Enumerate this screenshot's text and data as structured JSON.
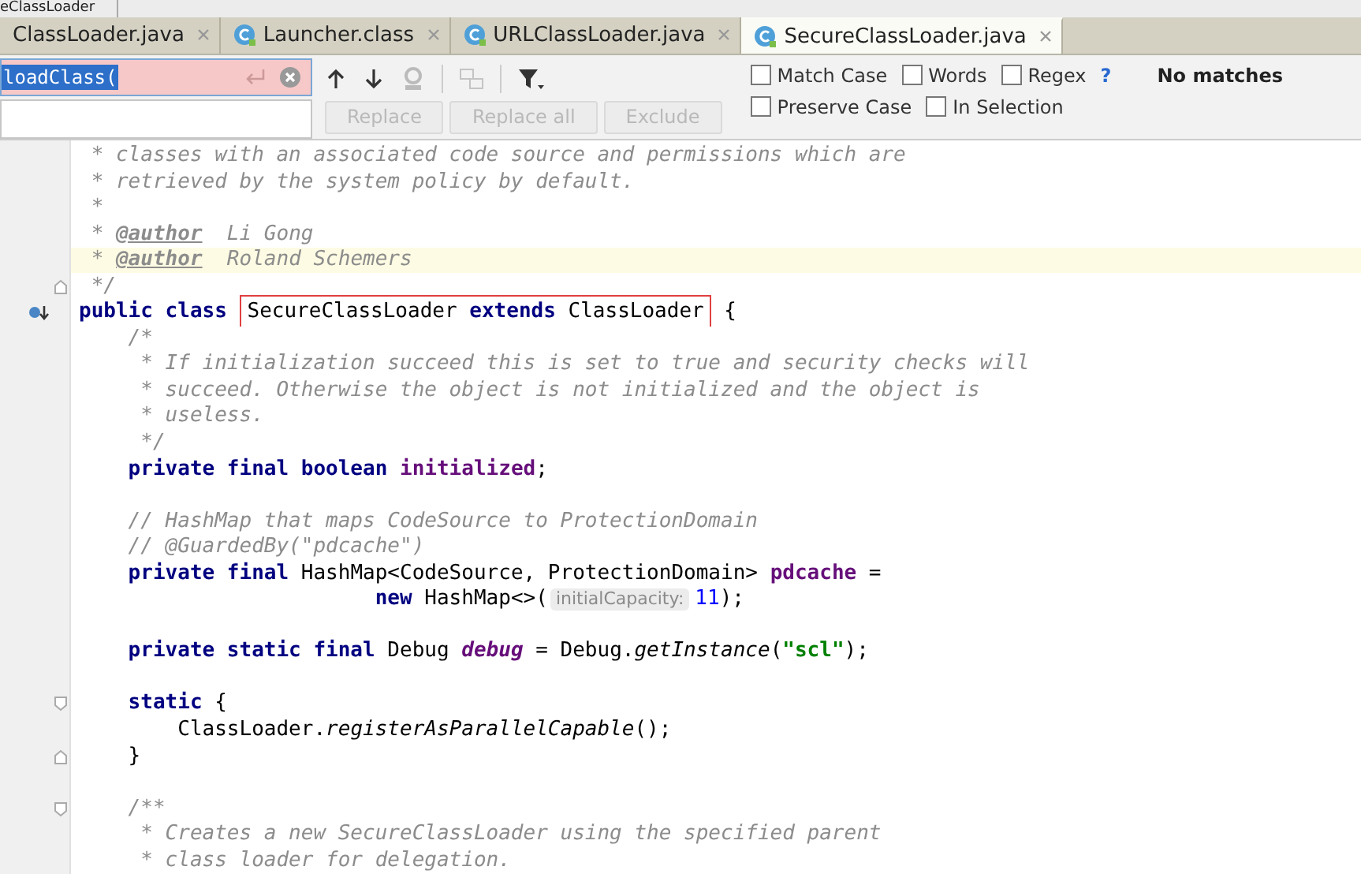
{
  "breadcrumb": "eClassLoader",
  "tabs": [
    {
      "label": "ClassLoader.java",
      "selected": false,
      "icon": false
    },
    {
      "label": "Launcher.class",
      "selected": false,
      "icon": true
    },
    {
      "label": "URLClassLoader.java",
      "selected": false,
      "icon": true
    },
    {
      "label": "SecureClassLoader.java",
      "selected": true,
      "icon": true
    }
  ],
  "find": {
    "query": "loadClass(",
    "no_match": true,
    "replace_buttons": [
      {
        "label": "Replace",
        "disabled": true
      },
      {
        "label": "Replace all",
        "disabled": true
      },
      {
        "label": "Exclude",
        "disabled": true
      }
    ],
    "options_row1": [
      {
        "label": "Match Case",
        "checked": false
      },
      {
        "label": "Words",
        "checked": false
      },
      {
        "label": "Regex",
        "checked": false
      }
    ],
    "help": "?",
    "status": "No matches",
    "options_row2": [
      {
        "label": "Preserve Case",
        "checked": false
      },
      {
        "label": "In Selection",
        "checked": false
      }
    ]
  },
  "lines": [
    {
      "current": false,
      "tokens": [
        {
          "kind": "comment",
          "text": " * classes with an associated code source and permissions which are"
        }
      ]
    },
    {
      "current": false,
      "tokens": [
        {
          "kind": "comment",
          "text": " * retrieved by the system policy by default."
        }
      ]
    },
    {
      "current": false,
      "tokens": [
        {
          "kind": "comment",
          "text": " *"
        }
      ]
    },
    {
      "current": false,
      "tokens": [
        {
          "kind": "comment",
          "text": " * "
        },
        {
          "kind": "doctag",
          "text": "@author"
        },
        {
          "kind": "comment",
          "text": "  Li Gong"
        }
      ]
    },
    {
      "current": true,
      "tokens": [
        {
          "kind": "comment",
          "text": " * "
        },
        {
          "kind": "doctag",
          "text": "@author"
        },
        {
          "kind": "comment",
          "text": "  Roland Schemers"
        }
      ]
    },
    {
      "current": false,
      "kind": "fold-end",
      "tokens": [
        {
          "kind": "comment",
          "text": " */"
        }
      ]
    },
    {
      "current": false,
      "kind": "override",
      "tokens": [
        {
          "kind": "keyword",
          "text": "public class "
        },
        {
          "kind": "box",
          "tokens": [
            {
              "kind": "plain",
              "text": "SecureClassLoader "
            },
            {
              "kind": "keyword",
              "text": "extends "
            },
            {
              "kind": "plain",
              "text": "ClassLoader"
            }
          ]
        },
        {
          "kind": "plain",
          "text": " {"
        }
      ]
    },
    {
      "current": false,
      "tokens": [
        {
          "kind": "comment",
          "text": "    /*"
        }
      ]
    },
    {
      "current": false,
      "tokens": [
        {
          "kind": "comment",
          "text": "     * If initialization succeed this is set to true and security checks will"
        }
      ]
    },
    {
      "current": false,
      "tokens": [
        {
          "kind": "comment",
          "text": "     * succeed. Otherwise the object is not initialized and the object is"
        }
      ]
    },
    {
      "current": false,
      "tokens": [
        {
          "kind": "comment",
          "text": "     * useless."
        }
      ]
    },
    {
      "current": false,
      "tokens": [
        {
          "kind": "comment",
          "text": "     */"
        }
      ]
    },
    {
      "current": false,
      "tokens": [
        {
          "kind": "keyword",
          "text": "    private final boolean "
        },
        {
          "kind": "field",
          "text": "initialized"
        },
        {
          "kind": "plain",
          "text": ";"
        }
      ]
    },
    {
      "current": false
    },
    {
      "current": false,
      "tokens": [
        {
          "kind": "comment",
          "text": "    // HashMap that maps CodeSource to ProtectionDomain"
        }
      ]
    },
    {
      "current": false,
      "tokens": [
        {
          "kind": "comment",
          "text": "    // @GuardedBy(\"pdcache\")"
        }
      ]
    },
    {
      "current": false,
      "tokens": [
        {
          "kind": "keyword",
          "text": "    private final "
        },
        {
          "kind": "plain",
          "text": "HashMap<CodeSource, ProtectionDomain> "
        },
        {
          "kind": "field",
          "text": "pdcache"
        },
        {
          "kind": "plain",
          "text": " ="
        }
      ]
    },
    {
      "current": false,
      "tokens": [
        {
          "kind": "keyword",
          "text": "                        new "
        },
        {
          "kind": "plain",
          "text": "HashMap<>("
        },
        {
          "kind": "hint",
          "text": "initialCapacity:"
        },
        {
          "kind": "number",
          "text": "11"
        },
        {
          "kind": "plain",
          "text": ");"
        }
      ]
    },
    {
      "current": false
    },
    {
      "current": false,
      "tokens": [
        {
          "kind": "keyword",
          "text": "    private static final "
        },
        {
          "kind": "plain",
          "text": "Debug "
        },
        {
          "kind": "staticfield",
          "text": "debug"
        },
        {
          "kind": "plain",
          "text": " = Debug."
        },
        {
          "kind": "method",
          "text": "getInstance"
        },
        {
          "kind": "plain",
          "text": "("
        },
        {
          "kind": "string",
          "text": "\"scl\""
        },
        {
          "kind": "plain",
          "text": ");"
        }
      ]
    },
    {
      "current": false
    },
    {
      "current": false,
      "kind": "fold-start",
      "tokens": [
        {
          "kind": "keyword",
          "text": "    static "
        },
        {
          "kind": "plain",
          "text": "{"
        }
      ]
    },
    {
      "current": false,
      "tokens": [
        {
          "kind": "plain",
          "text": "        ClassLoader."
        },
        {
          "kind": "method",
          "text": "registerAsParallelCapable"
        },
        {
          "kind": "plain",
          "text": "();"
        }
      ]
    },
    {
      "current": false,
      "kind": "fold-end",
      "tokens": [
        {
          "kind": "plain",
          "text": "    }"
        }
      ]
    },
    {
      "current": false
    },
    {
      "current": false,
      "kind": "fold-start",
      "tokens": [
        {
          "kind": "comment",
          "text": "    /**"
        }
      ]
    },
    {
      "current": false,
      "tokens": [
        {
          "kind": "comment",
          "text": "     * Creates a new SecureClassLoader using the specified parent"
        }
      ]
    },
    {
      "current": false,
      "tokens": [
        {
          "kind": "comment",
          "text": "     * class loader for delegation."
        }
      ]
    }
  ]
}
